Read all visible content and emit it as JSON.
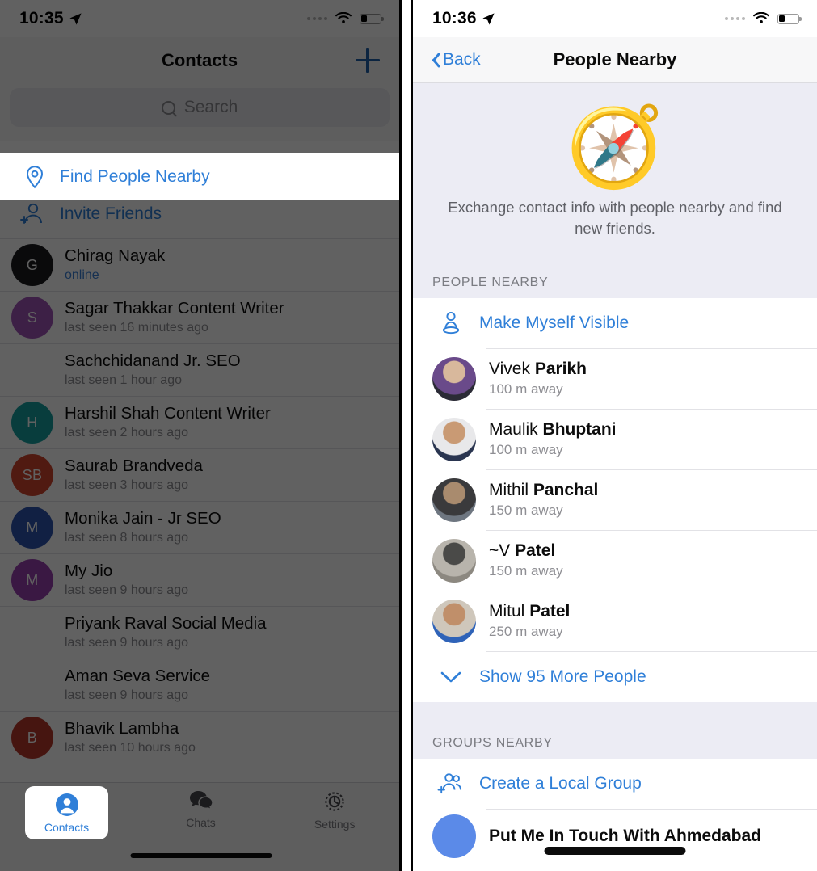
{
  "left_screen": {
    "status_bar": {
      "time": "10:35",
      "location_icon": "location-arrow-icon",
      "wifi_icon": "wifi-icon",
      "battery_icon": "battery-icon",
      "battery_level": 30
    },
    "nav": {
      "title": "Contacts",
      "add_icon": "plus-icon"
    },
    "search": {
      "placeholder": "Search",
      "icon": "search-icon"
    },
    "find_people_nearby": {
      "label": "Find People Nearby",
      "icon": "location-pin-icon",
      "highlighted": true
    },
    "invite_friends": {
      "label": "Invite Friends",
      "icon": "add-person-icon"
    },
    "contacts": [
      {
        "name": "Chirag Nayak",
        "status": "online",
        "online": true,
        "avatar_text": "G",
        "avatar_color": "#1b1b1f"
      },
      {
        "name": "Sagar Thakkar Content Writer",
        "status": "last seen 16 minutes ago",
        "online": false,
        "avatar_text": "S",
        "avatar_color": "#a055b8"
      },
      {
        "name": "Sachchidanand Jr. SEO",
        "status": "last seen 1 hour ago",
        "online": false,
        "avatar_text": "",
        "avatar_color": "transparent"
      },
      {
        "name": "Harshil Shah Content Writer",
        "status": "last seen 2 hours ago",
        "online": false,
        "avatar_text": "H",
        "avatar_color": "#16a0a0"
      },
      {
        "name": "Saurab Brandveda",
        "status": "last seen 3 hours ago",
        "online": false,
        "avatar_text": "SB",
        "avatar_color": "#d2452f"
      },
      {
        "name": "Monika Jain - Jr SEO",
        "status": "last seen 8 hours ago",
        "online": false,
        "avatar_text": "M",
        "avatar_color": "#2f55b0"
      },
      {
        "name": "My Jio",
        "status": "last seen 9 hours ago",
        "online": false,
        "avatar_text": "M",
        "avatar_color": "#9a3fb0"
      },
      {
        "name": "Priyank Raval Social Media",
        "status": "last seen 9 hours ago",
        "online": false,
        "avatar_text": "",
        "avatar_color": "transparent"
      },
      {
        "name": "Aman Seva Service",
        "status": "last seen 9 hours ago",
        "online": false,
        "avatar_text": "",
        "avatar_color": "transparent"
      },
      {
        "name": "Bhavik Lambha",
        "status": "last seen 10 hours ago",
        "online": false,
        "avatar_text": "B",
        "avatar_color": "#b8382c"
      }
    ],
    "tabs": [
      {
        "label": "Contacts",
        "icon": "person-icon",
        "active": true
      },
      {
        "label": "Chats",
        "icon": "chat-bubbles-icon",
        "active": false
      },
      {
        "label": "Settings",
        "icon": "gear-icon",
        "active": false
      }
    ]
  },
  "right_screen": {
    "status_bar": {
      "time": "10:36",
      "location_icon": "location-arrow-icon",
      "wifi_icon": "wifi-icon",
      "battery_icon": "battery-icon",
      "battery_level": 30
    },
    "nav": {
      "back_label": "Back",
      "back_icon": "chevron-left-icon",
      "title": "People Nearby"
    },
    "hero": {
      "icon": "compass-icon",
      "glyph": "🧭",
      "description": "Exchange contact info with people nearby and find new friends."
    },
    "people_section": {
      "header": "PEOPLE NEARBY",
      "make_visible": {
        "label": "Make Myself Visible",
        "icon": "visibility-person-icon"
      },
      "people": [
        {
          "first": "Vivek ",
          "last": "Parikh",
          "distance": "100 m away",
          "avatar": "photo-vivek"
        },
        {
          "first": "Maulik ",
          "last": "Bhuptani",
          "distance": "100 m away",
          "avatar": "photo-maulik"
        },
        {
          "first": "Mithil ",
          "last": "Panchal",
          "distance": "150 m away",
          "avatar": "photo-mithil"
        },
        {
          "first": "~V ",
          "last": "Patel",
          "distance": "150 m away",
          "avatar": "photo-v"
        },
        {
          "first": "Mitul ",
          "last": "Patel",
          "distance": "250 m away",
          "avatar": "photo-mitul"
        }
      ],
      "show_more": {
        "label": "Show 95 More People",
        "icon": "chevron-down-icon",
        "count": 95
      }
    },
    "groups_section": {
      "header": "GROUPS NEARBY",
      "create_group": {
        "label": "Create a Local Group",
        "icon": "add-group-icon"
      },
      "groups": [
        {
          "name": "Put Me In Touch With Ahmedabad"
        }
      ]
    }
  },
  "colors": {
    "accent_blue": "#2f7fd8",
    "lavender_bg": "#ececf4",
    "subtitle_gray": "#8e8e93"
  }
}
